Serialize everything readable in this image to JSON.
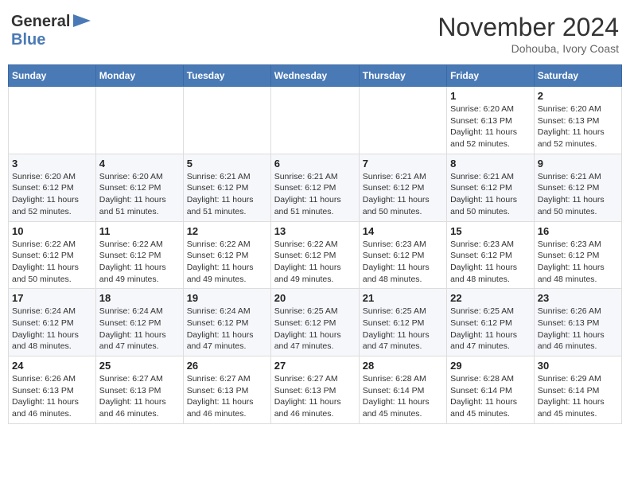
{
  "header": {
    "logo_line1": "General",
    "logo_line2": "Blue",
    "month": "November 2024",
    "location": "Dohouba, Ivory Coast"
  },
  "weekdays": [
    "Sunday",
    "Monday",
    "Tuesday",
    "Wednesday",
    "Thursday",
    "Friday",
    "Saturday"
  ],
  "weeks": [
    [
      {
        "day": "",
        "info": ""
      },
      {
        "day": "",
        "info": ""
      },
      {
        "day": "",
        "info": ""
      },
      {
        "day": "",
        "info": ""
      },
      {
        "day": "",
        "info": ""
      },
      {
        "day": "1",
        "info": "Sunrise: 6:20 AM\nSunset: 6:13 PM\nDaylight: 11 hours\nand 52 minutes."
      },
      {
        "day": "2",
        "info": "Sunrise: 6:20 AM\nSunset: 6:13 PM\nDaylight: 11 hours\nand 52 minutes."
      }
    ],
    [
      {
        "day": "3",
        "info": "Sunrise: 6:20 AM\nSunset: 6:12 PM\nDaylight: 11 hours\nand 52 minutes."
      },
      {
        "day": "4",
        "info": "Sunrise: 6:20 AM\nSunset: 6:12 PM\nDaylight: 11 hours\nand 51 minutes."
      },
      {
        "day": "5",
        "info": "Sunrise: 6:21 AM\nSunset: 6:12 PM\nDaylight: 11 hours\nand 51 minutes."
      },
      {
        "day": "6",
        "info": "Sunrise: 6:21 AM\nSunset: 6:12 PM\nDaylight: 11 hours\nand 51 minutes."
      },
      {
        "day": "7",
        "info": "Sunrise: 6:21 AM\nSunset: 6:12 PM\nDaylight: 11 hours\nand 50 minutes."
      },
      {
        "day": "8",
        "info": "Sunrise: 6:21 AM\nSunset: 6:12 PM\nDaylight: 11 hours\nand 50 minutes."
      },
      {
        "day": "9",
        "info": "Sunrise: 6:21 AM\nSunset: 6:12 PM\nDaylight: 11 hours\nand 50 minutes."
      }
    ],
    [
      {
        "day": "10",
        "info": "Sunrise: 6:22 AM\nSunset: 6:12 PM\nDaylight: 11 hours\nand 50 minutes."
      },
      {
        "day": "11",
        "info": "Sunrise: 6:22 AM\nSunset: 6:12 PM\nDaylight: 11 hours\nand 49 minutes."
      },
      {
        "day": "12",
        "info": "Sunrise: 6:22 AM\nSunset: 6:12 PM\nDaylight: 11 hours\nand 49 minutes."
      },
      {
        "day": "13",
        "info": "Sunrise: 6:22 AM\nSunset: 6:12 PM\nDaylight: 11 hours\nand 49 minutes."
      },
      {
        "day": "14",
        "info": "Sunrise: 6:23 AM\nSunset: 6:12 PM\nDaylight: 11 hours\nand 48 minutes."
      },
      {
        "day": "15",
        "info": "Sunrise: 6:23 AM\nSunset: 6:12 PM\nDaylight: 11 hours\nand 48 minutes."
      },
      {
        "day": "16",
        "info": "Sunrise: 6:23 AM\nSunset: 6:12 PM\nDaylight: 11 hours\nand 48 minutes."
      }
    ],
    [
      {
        "day": "17",
        "info": "Sunrise: 6:24 AM\nSunset: 6:12 PM\nDaylight: 11 hours\nand 48 minutes."
      },
      {
        "day": "18",
        "info": "Sunrise: 6:24 AM\nSunset: 6:12 PM\nDaylight: 11 hours\nand 47 minutes."
      },
      {
        "day": "19",
        "info": "Sunrise: 6:24 AM\nSunset: 6:12 PM\nDaylight: 11 hours\nand 47 minutes."
      },
      {
        "day": "20",
        "info": "Sunrise: 6:25 AM\nSunset: 6:12 PM\nDaylight: 11 hours\nand 47 minutes."
      },
      {
        "day": "21",
        "info": "Sunrise: 6:25 AM\nSunset: 6:12 PM\nDaylight: 11 hours\nand 47 minutes."
      },
      {
        "day": "22",
        "info": "Sunrise: 6:25 AM\nSunset: 6:12 PM\nDaylight: 11 hours\nand 47 minutes."
      },
      {
        "day": "23",
        "info": "Sunrise: 6:26 AM\nSunset: 6:13 PM\nDaylight: 11 hours\nand 46 minutes."
      }
    ],
    [
      {
        "day": "24",
        "info": "Sunrise: 6:26 AM\nSunset: 6:13 PM\nDaylight: 11 hours\nand 46 minutes."
      },
      {
        "day": "25",
        "info": "Sunrise: 6:27 AM\nSunset: 6:13 PM\nDaylight: 11 hours\nand 46 minutes."
      },
      {
        "day": "26",
        "info": "Sunrise: 6:27 AM\nSunset: 6:13 PM\nDaylight: 11 hours\nand 46 minutes."
      },
      {
        "day": "27",
        "info": "Sunrise: 6:27 AM\nSunset: 6:13 PM\nDaylight: 11 hours\nand 46 minutes."
      },
      {
        "day": "28",
        "info": "Sunrise: 6:28 AM\nSunset: 6:14 PM\nDaylight: 11 hours\nand 45 minutes."
      },
      {
        "day": "29",
        "info": "Sunrise: 6:28 AM\nSunset: 6:14 PM\nDaylight: 11 hours\nand 45 minutes."
      },
      {
        "day": "30",
        "info": "Sunrise: 6:29 AM\nSunset: 6:14 PM\nDaylight: 11 hours\nand 45 minutes."
      }
    ]
  ]
}
